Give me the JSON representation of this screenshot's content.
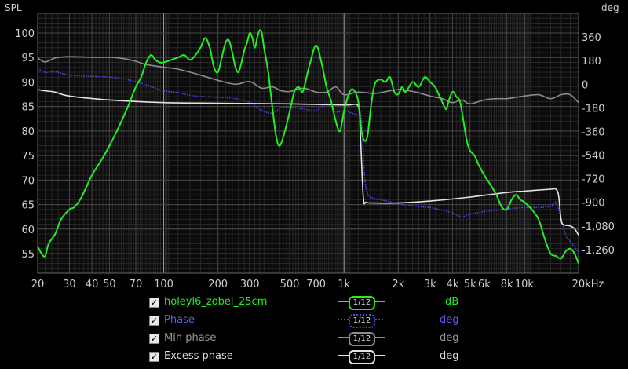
{
  "header": {
    "left_axis_title": "SPL",
    "right_axis_title": "deg"
  },
  "chart_data": {
    "type": "line",
    "xscale": "log",
    "xlim": [
      20,
      20000
    ],
    "xticks": [
      {
        "v": 20,
        "label": "20"
      },
      {
        "v": 30,
        "label": "30"
      },
      {
        "v": 40,
        "label": "40"
      },
      {
        "v": 50,
        "label": "50"
      },
      {
        "v": 70,
        "label": "70"
      },
      {
        "v": 100,
        "label": "100"
      },
      {
        "v": 200,
        "label": "200"
      },
      {
        "v": 300,
        "label": "300"
      },
      {
        "v": 500,
        "label": "500"
      },
      {
        "v": 700,
        "label": "700"
      },
      {
        "v": 1000,
        "label": "1k"
      },
      {
        "v": 2000,
        "label": "2k"
      },
      {
        "v": 3000,
        "label": "3k"
      },
      {
        "v": 4000,
        "label": "4k"
      },
      {
        "v": 5000,
        "label": "5k"
      },
      {
        "v": 6000,
        "label": "6k"
      },
      {
        "v": 8000,
        "label": "8k"
      },
      {
        "v": 10000,
        "label": "10k"
      },
      {
        "v": 20000,
        "label": "20kHz"
      }
    ],
    "ylim_left": [
      51,
      104
    ],
    "yticks_left": [
      55,
      60,
      65,
      70,
      75,
      80,
      85,
      90,
      95,
      100
    ],
    "ylim_right": [
      -1440,
      540
    ],
    "yticks_right": [
      {
        "v": 360,
        "label": "360"
      },
      {
        "v": 180,
        "label": "180"
      },
      {
        "v": 0,
        "label": "0"
      },
      {
        "v": -180,
        "label": "-180"
      },
      {
        "v": -360,
        "label": "-360"
      },
      {
        "v": -540,
        "label": "-540"
      },
      {
        "v": -720,
        "label": "-720"
      },
      {
        "v": -900,
        "label": "-900"
      },
      {
        "v": -1080,
        "label": "-1,080"
      },
      {
        "v": -1260,
        "label": "-1,260"
      }
    ],
    "grid": true,
    "series": [
      {
        "name": "holeyl6_zobel_25cm",
        "axis": "left",
        "color": "#22ee22",
        "style": "solid",
        "unit": "dB",
        "points": [
          [
            20,
            56.5
          ],
          [
            21,
            55
          ],
          [
            22,
            54.5
          ],
          [
            23,
            57
          ],
          [
            25,
            59
          ],
          [
            27,
            62
          ],
          [
            30,
            64
          ],
          [
            32,
            64.5
          ],
          [
            35,
            66.5
          ],
          [
            40,
            71
          ],
          [
            45,
            74
          ],
          [
            50,
            77
          ],
          [
            55,
            80
          ],
          [
            60,
            83
          ],
          [
            65,
            86
          ],
          [
            70,
            89
          ],
          [
            75,
            91
          ],
          [
            80,
            94
          ],
          [
            85,
            95.5
          ],
          [
            90,
            94.5
          ],
          [
            95,
            94
          ],
          [
            100,
            94
          ],
          [
            110,
            94.5
          ],
          [
            120,
            95
          ],
          [
            130,
            95.5
          ],
          [
            140,
            94.5
          ],
          [
            150,
            95.5
          ],
          [
            160,
            97
          ],
          [
            170,
            99
          ],
          [
            180,
            97
          ],
          [
            190,
            93
          ],
          [
            200,
            92
          ],
          [
            210,
            95
          ],
          [
            220,
            98
          ],
          [
            230,
            98.5
          ],
          [
            240,
            96
          ],
          [
            250,
            93
          ],
          [
            260,
            92
          ],
          [
            270,
            94
          ],
          [
            280,
            96.5
          ],
          [
            290,
            98
          ],
          [
            300,
            100
          ],
          [
            310,
            99
          ],
          [
            320,
            97
          ],
          [
            330,
            99
          ],
          [
            340,
            100.5
          ],
          [
            350,
            100
          ],
          [
            360,
            97
          ],
          [
            380,
            92
          ],
          [
            400,
            85
          ],
          [
            420,
            79
          ],
          [
            440,
            77
          ],
          [
            470,
            80
          ],
          [
            500,
            84
          ],
          [
            530,
            88
          ],
          [
            560,
            89
          ],
          [
            590,
            88
          ],
          [
            620,
            91
          ],
          [
            650,
            94
          ],
          [
            700,
            97.5
          ],
          [
            750,
            94
          ],
          [
            800,
            89
          ],
          [
            850,
            86
          ],
          [
            900,
            82
          ],
          [
            950,
            80
          ],
          [
            1000,
            84
          ],
          [
            1050,
            87
          ],
          [
            1100,
            88.5
          ],
          [
            1150,
            88
          ],
          [
            1200,
            86
          ],
          [
            1250,
            80
          ],
          [
            1300,
            78
          ],
          [
            1350,
            79
          ],
          [
            1400,
            84
          ],
          [
            1450,
            88
          ],
          [
            1500,
            90
          ],
          [
            1600,
            90.5
          ],
          [
            1700,
            90
          ],
          [
            1800,
            91
          ],
          [
            1900,
            88
          ],
          [
            2000,
            87.5
          ],
          [
            2100,
            89
          ],
          [
            2200,
            88
          ],
          [
            2400,
            90
          ],
          [
            2600,
            89
          ],
          [
            2800,
            91
          ],
          [
            3000,
            90
          ],
          [
            3200,
            89
          ],
          [
            3400,
            87
          ],
          [
            3600,
            85
          ],
          [
            3700,
            84.5
          ],
          [
            3800,
            86
          ],
          [
            4000,
            88
          ],
          [
            4200,
            87
          ],
          [
            4400,
            86
          ],
          [
            4600,
            82
          ],
          [
            4800,
            78
          ],
          [
            5000,
            76
          ],
          [
            5300,
            75
          ],
          [
            5600,
            73
          ],
          [
            6000,
            71
          ],
          [
            6500,
            69
          ],
          [
            7000,
            67
          ],
          [
            7500,
            64.5
          ],
          [
            8000,
            64
          ],
          [
            8500,
            66
          ],
          [
            9000,
            67
          ],
          [
            9500,
            66
          ],
          [
            10000,
            65.5
          ],
          [
            11000,
            64
          ],
          [
            12000,
            62
          ],
          [
            13000,
            58
          ],
          [
            14000,
            55
          ],
          [
            15000,
            54.5
          ],
          [
            16000,
            54
          ],
          [
            17000,
            55.5
          ],
          [
            18000,
            56
          ],
          [
            19000,
            55
          ],
          [
            20000,
            53
          ]
        ]
      },
      {
        "name": "Phase",
        "axis": "right",
        "color": "#4a4aee",
        "style": "dotted",
        "unit": "deg",
        "points": [
          [
            20,
            120
          ],
          [
            22,
            90
          ],
          [
            25,
            95
          ],
          [
            30,
            70
          ],
          [
            40,
            60
          ],
          [
            50,
            55
          ],
          [
            60,
            40
          ],
          [
            70,
            20
          ],
          [
            80,
            -5
          ],
          [
            90,
            -30
          ],
          [
            100,
            -50
          ],
          [
            120,
            -65
          ],
          [
            150,
            -90
          ],
          [
            200,
            -100
          ],
          [
            250,
            -110
          ],
          [
            300,
            -140
          ],
          [
            350,
            -200
          ],
          [
            400,
            -220
          ],
          [
            450,
            -180
          ],
          [
            500,
            -175
          ],
          [
            600,
            -190
          ],
          [
            700,
            -200
          ],
          [
            800,
            -150
          ],
          [
            900,
            -210
          ],
          [
            1000,
            -200
          ],
          [
            1100,
            -220
          ],
          [
            1200,
            -240
          ],
          [
            1250,
            -280
          ],
          [
            1300,
            -700
          ],
          [
            1350,
            -830
          ],
          [
            1400,
            -860
          ],
          [
            1600,
            -880
          ],
          [
            2000,
            -910
          ],
          [
            2500,
            -930
          ],
          [
            3000,
            -940
          ],
          [
            3500,
            -960
          ],
          [
            4000,
            -980
          ],
          [
            4500,
            -1010
          ],
          [
            5000,
            -990
          ],
          [
            6000,
            -970
          ],
          [
            7000,
            -960
          ],
          [
            8000,
            -950
          ],
          [
            10000,
            -940
          ],
          [
            12000,
            -940
          ],
          [
            14000,
            -930
          ],
          [
            15000,
            -900
          ],
          [
            16000,
            -1020
          ],
          [
            17000,
            -1150
          ],
          [
            18000,
            -1200
          ],
          [
            19000,
            -1240
          ],
          [
            20000,
            -1280
          ]
        ]
      },
      {
        "name": "Min phase",
        "axis": "right",
        "color": "#8c8c8c",
        "style": "solid",
        "unit": "deg",
        "points": [
          [
            20,
            200
          ],
          [
            22,
            170
          ],
          [
            25,
            200
          ],
          [
            30,
            210
          ],
          [
            40,
            205
          ],
          [
            50,
            205
          ],
          [
            60,
            195
          ],
          [
            70,
            175
          ],
          [
            80,
            150
          ],
          [
            100,
            130
          ],
          [
            120,
            115
          ],
          [
            150,
            80
          ],
          [
            200,
            30
          ],
          [
            250,
            0
          ],
          [
            300,
            20
          ],
          [
            350,
            -30
          ],
          [
            400,
            -20
          ],
          [
            450,
            -50
          ],
          [
            500,
            -55
          ],
          [
            600,
            -30
          ],
          [
            700,
            -60
          ],
          [
            800,
            -60
          ],
          [
            900,
            -20
          ],
          [
            1000,
            -80
          ],
          [
            1200,
            -60
          ],
          [
            1500,
            -70
          ],
          [
            2000,
            -40
          ],
          [
            2500,
            -60
          ],
          [
            3000,
            -90
          ],
          [
            3500,
            -110
          ],
          [
            4000,
            -140
          ],
          [
            4500,
            -120
          ],
          [
            5000,
            -150
          ],
          [
            6000,
            -120
          ],
          [
            7000,
            -110
          ],
          [
            8000,
            -110
          ],
          [
            9000,
            -100
          ],
          [
            10000,
            -90
          ],
          [
            12000,
            -80
          ],
          [
            14000,
            -110
          ],
          [
            16000,
            -80
          ],
          [
            18000,
            -80
          ],
          [
            20000,
            -140
          ]
        ]
      },
      {
        "name": "Excess phase",
        "axis": "right",
        "color": "#e4e4e4",
        "style": "solid",
        "unit": "deg",
        "points": [
          [
            20,
            -40
          ],
          [
            22,
            -50
          ],
          [
            25,
            -60
          ],
          [
            30,
            -90
          ],
          [
            50,
            -120
          ],
          [
            100,
            -140
          ],
          [
            200,
            -145
          ],
          [
            500,
            -150
          ],
          [
            1000,
            -158
          ],
          [
            1200,
            -168
          ],
          [
            1230,
            -350
          ],
          [
            1280,
            -860
          ],
          [
            1330,
            -900
          ],
          [
            1500,
            -905
          ],
          [
            2000,
            -905
          ],
          [
            3000,
            -890
          ],
          [
            5000,
            -860
          ],
          [
            8000,
            -825
          ],
          [
            10000,
            -815
          ],
          [
            14000,
            -800
          ],
          [
            15000,
            -800
          ],
          [
            15500,
            -850
          ],
          [
            16000,
            -1030
          ],
          [
            16500,
            -1070
          ],
          [
            18000,
            -1080
          ],
          [
            19000,
            -1100
          ],
          [
            20000,
            -1150
          ]
        ]
      }
    ]
  },
  "legend": [
    {
      "name": "holeyl6_zobel_25cm",
      "smoothing": "1/12",
      "unit": "dB",
      "color": "#22ee22",
      "style": "solid"
    },
    {
      "name": "Phase",
      "smoothing": "1/12",
      "unit": "deg",
      "color": "#4a4aee",
      "style": "dotted"
    },
    {
      "name": "Min phase",
      "smoothing": "1/12",
      "unit": "deg",
      "color": "#8c8c8c",
      "style": "solid"
    },
    {
      "name": "Excess phase",
      "smoothing": "1/12",
      "unit": "deg",
      "color": "#e4e4e4",
      "style": "solid"
    }
  ]
}
